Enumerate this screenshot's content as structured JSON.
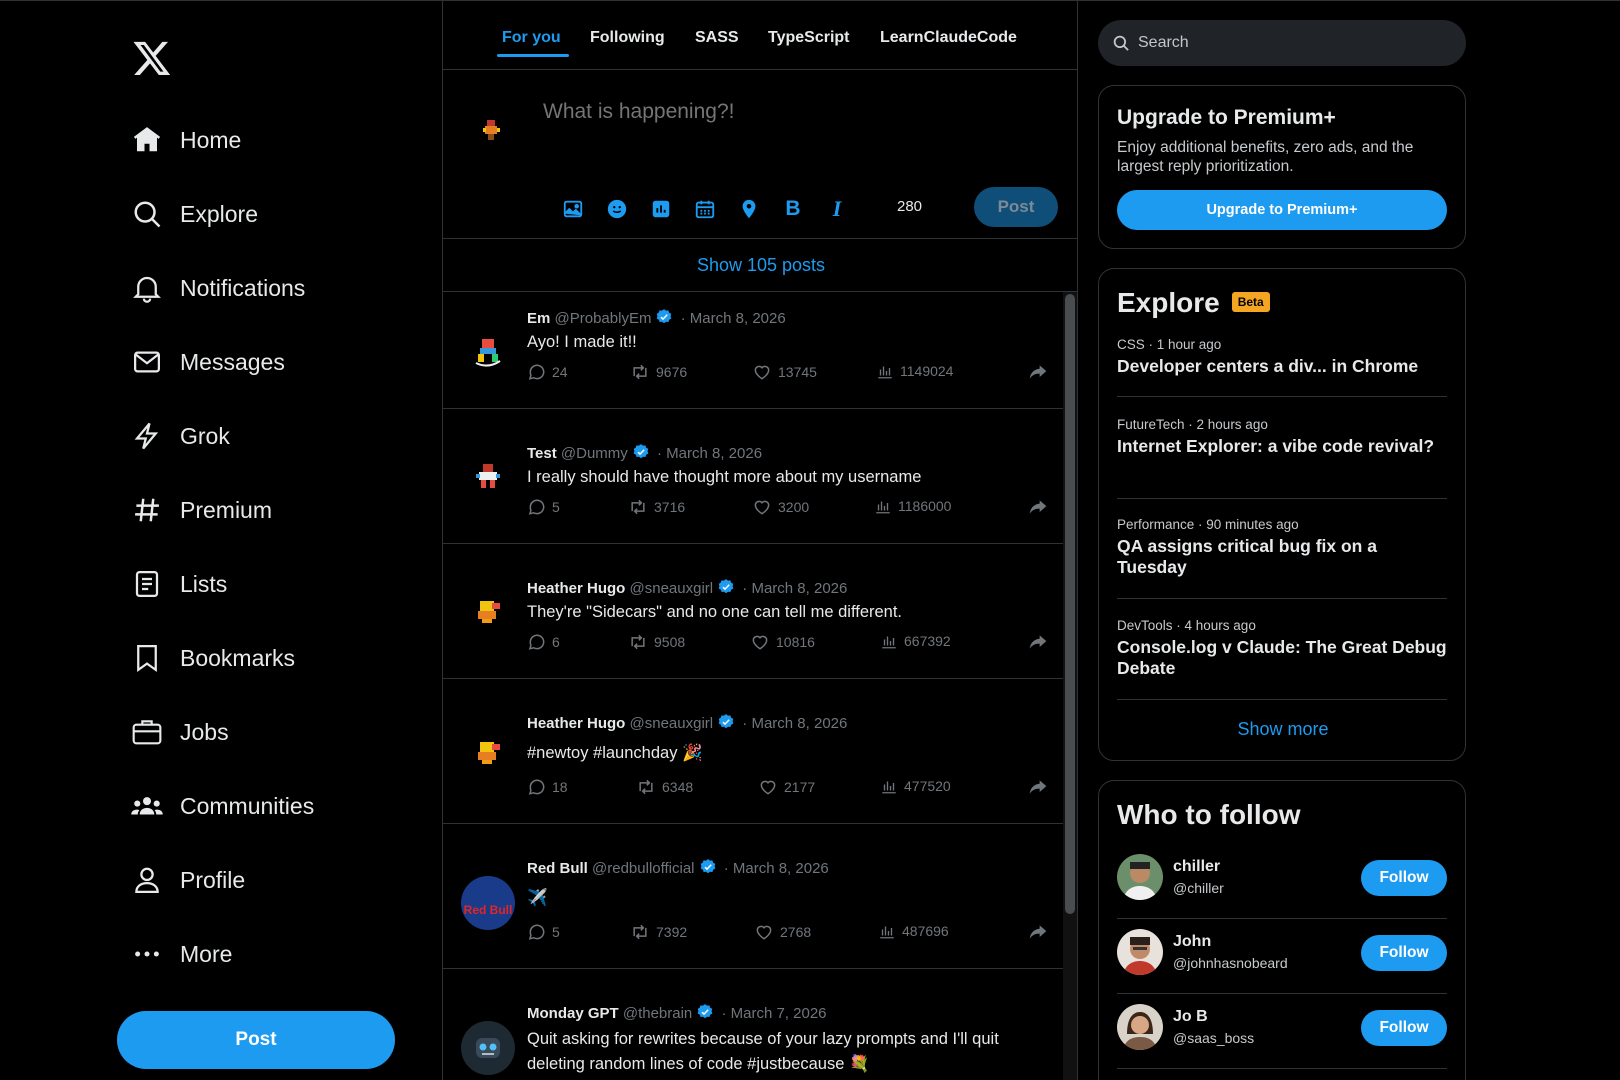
{
  "colors": {
    "accent": "#1d9bf0",
    "background": "#000000",
    "muted": "#71767b",
    "beta": "#f4a622"
  },
  "nav": [
    {
      "key": "home",
      "label": "Home",
      "icon": "home-icon"
    },
    {
      "key": "explore",
      "label": "Explore",
      "icon": "search-icon"
    },
    {
      "key": "notifications",
      "label": "Notifications",
      "icon": "bell-icon"
    },
    {
      "key": "messages",
      "label": "Messages",
      "icon": "mail-icon"
    },
    {
      "key": "grok",
      "label": "Grok",
      "icon": "bolt-icon"
    },
    {
      "key": "premium",
      "label": "Premium",
      "icon": "hash-icon"
    },
    {
      "key": "lists",
      "label": "Lists",
      "icon": "list-icon"
    },
    {
      "key": "bookmarks",
      "label": "Bookmarks",
      "icon": "bookmark-icon"
    },
    {
      "key": "jobs",
      "label": "Jobs",
      "icon": "briefcase-icon"
    },
    {
      "key": "communities",
      "label": "Communities",
      "icon": "people-icon"
    },
    {
      "key": "profile",
      "label": "Profile",
      "icon": "user-icon"
    },
    {
      "key": "more",
      "label": "More",
      "icon": "more-icon"
    }
  ],
  "sidebar": {
    "post_label": "Post"
  },
  "tabs": [
    "For you",
    "Following",
    "SASS",
    "TypeScript",
    "LearnClaudeCode"
  ],
  "composer": {
    "placeholder": "What is happening?!",
    "char_count": "280",
    "post_label": "Post",
    "tools": [
      "image-icon",
      "emoji-icon",
      "gif-icon",
      "schedule-icon",
      "location-icon",
      "bold-icon",
      "italic-icon"
    ],
    "bold_glyph": "B",
    "italic_glyph": "I"
  },
  "show_posts": "Show 105 posts",
  "tweets": [
    {
      "name": "Em",
      "handle": "@ProbablyEm",
      "dot": "·",
      "date": "March 8, 2026",
      "text": "Ayo! I made it!!",
      "replies": "24",
      "retweets": "9676",
      "likes": "13745",
      "views": "1149024"
    },
    {
      "name": "Test",
      "handle": "@Dummy",
      "dot": "·",
      "date": "March 8, 2026",
      "text": "I really should have thought more about my username",
      "replies": "5",
      "retweets": "3716",
      "likes": "3200",
      "views": "1186000"
    },
    {
      "name": "Heather Hugo",
      "handle": "@sneauxgirl",
      "dot": "·",
      "date": "March 8, 2026",
      "text": "They're \"Sidecars\" and no one can tell me different.",
      "replies": "6",
      "retweets": "9508",
      "likes": "10816",
      "views": "667392"
    },
    {
      "name": "Heather Hugo",
      "handle": "@sneauxgirl",
      "dot": "·",
      "date": "March 8, 2026",
      "text": "#newtoy #launchday 🎉",
      "replies": "18",
      "retweets": "6348",
      "likes": "2177",
      "views": "477520"
    },
    {
      "name": "Red Bull",
      "handle": "@redbullofficial",
      "dot": "·",
      "date": "March 8, 2026",
      "text": "✈️",
      "replies": "5",
      "retweets": "7392",
      "likes": "2768",
      "views": "487696",
      "avatar_text": "Red Bull"
    },
    {
      "name": "Monday GPT",
      "handle": "@thebrain",
      "dot": "·",
      "date": "March 7, 2026",
      "text": "Quit asking for rewrites because of your lazy prompts and I'll quit deleting random lines of code #justbecause 💐"
    }
  ],
  "search": {
    "placeholder": "Search"
  },
  "premium": {
    "title": "Upgrade to Premium+",
    "description": "Enjoy additional benefits, zero ads, and the largest reply prioritization.",
    "button": "Upgrade to Premium+"
  },
  "explore": {
    "title": "Explore",
    "badge": "Beta",
    "trends": [
      {
        "meta": "CSS · 1 hour ago",
        "title": "Developer centers a div... in Chrome"
      },
      {
        "meta": "FutureTech · 2 hours ago",
        "title": "Internet Explorer: a vibe code revival?"
      },
      {
        "meta": "Performance · 90 minutes ago",
        "title": "QA assigns critical bug fix on a Tuesday"
      },
      {
        "meta": "DevTools · 4 hours ago",
        "title": "Console.log v Claude: The Great Debug Debate"
      }
    ],
    "show_more": "Show more"
  },
  "who_to_follow": {
    "title": "Who to follow",
    "users": [
      {
        "name": "chiller",
        "handle": "@chiller",
        "button": "Follow"
      },
      {
        "name": "John",
        "handle": "@johnhasnobeard",
        "button": "Follow"
      },
      {
        "name": "Jo B",
        "handle": "@saas_boss",
        "button": "Follow"
      }
    ]
  }
}
